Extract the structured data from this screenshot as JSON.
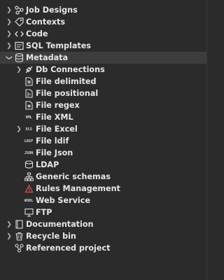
{
  "tree": {
    "items": [
      {
        "label": "Job Designs",
        "icon": "job-designs-icon",
        "arrow": "right"
      },
      {
        "label": "Contexts",
        "icon": "contexts-icon",
        "arrow": "right"
      },
      {
        "label": "Code",
        "icon": "code-icon",
        "arrow": "right"
      },
      {
        "label": "SQL Templates",
        "icon": "sql-templates-icon",
        "arrow": "right"
      },
      {
        "label": "Metadata",
        "icon": "metadata-icon",
        "arrow": "down"
      },
      {
        "label": "Db Connections",
        "icon": "db-connections-icon",
        "arrow": "right"
      },
      {
        "label": "File delimited",
        "icon": "file-delimited-icon",
        "arrow": ""
      },
      {
        "label": "File positional",
        "icon": "file-positional-icon",
        "arrow": ""
      },
      {
        "label": "File regex",
        "icon": "file-regex-icon",
        "arrow": ""
      },
      {
        "label": "File XML",
        "icon": "file-xml-icon",
        "arrow": "",
        "badge": "XML"
      },
      {
        "label": "File Excel",
        "icon": "file-excel-icon",
        "arrow": "right",
        "badge": "XLS"
      },
      {
        "label": "File ldif",
        "icon": "file-ldif-icon",
        "arrow": "",
        "badge": "LDIF"
      },
      {
        "label": "File Json",
        "icon": "file-json-icon",
        "arrow": "",
        "badge": "JSON"
      },
      {
        "label": "LDAP",
        "icon": "ldap-icon",
        "arrow": ""
      },
      {
        "label": "Generic schemas",
        "icon": "generic-schemas-icon",
        "arrow": ""
      },
      {
        "label": "Rules Management",
        "icon": "rules-management-icon",
        "arrow": ""
      },
      {
        "label": "Web Service",
        "icon": "web-service-icon",
        "arrow": "",
        "badge": "WSDL"
      },
      {
        "label": "FTP",
        "icon": "ftp-icon",
        "arrow": ""
      },
      {
        "label": "Documentation",
        "icon": "documentation-icon",
        "arrow": "right"
      },
      {
        "label": "Recycle bin",
        "icon": "recycle-bin-icon",
        "arrow": "right"
      },
      {
        "label": "Referenced project",
        "icon": "referenced-project-icon",
        "arrow": ""
      }
    ]
  },
  "colors": {
    "background": "#2b2b2b",
    "text": "#e6e6e6",
    "rules_icon": "#d9534f"
  }
}
